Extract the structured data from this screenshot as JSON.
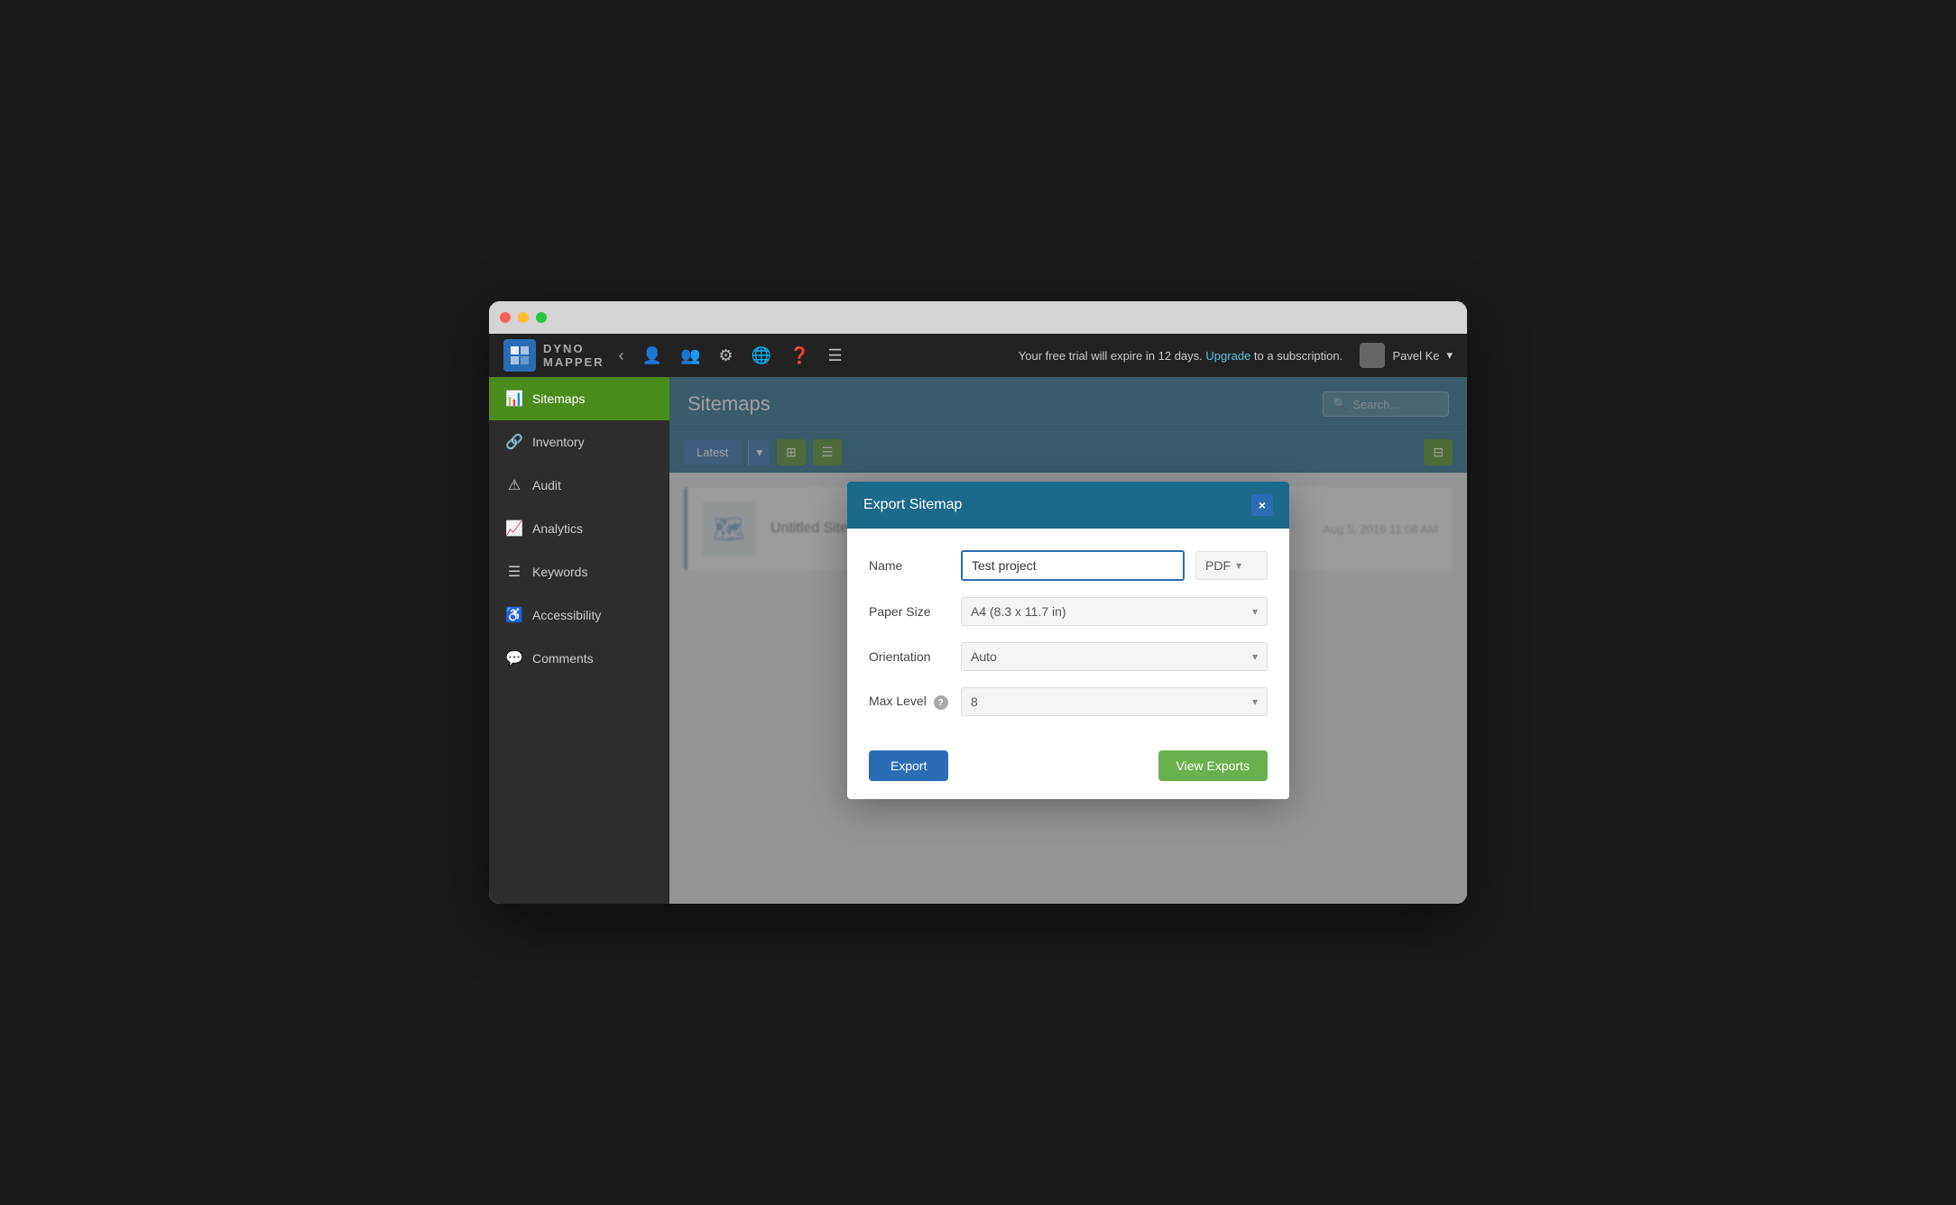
{
  "browser": {
    "dots": [
      "red",
      "yellow",
      "green"
    ]
  },
  "topnav": {
    "logo_text": "DYNO\nMAPPER",
    "trial_message": "Your free trial will expire in 12 days.",
    "upgrade_text": "Upgrade",
    "trial_suffix": " to a subscription.",
    "user_name": "Pavel Ke",
    "nav_icons": [
      "user-icon",
      "user-add-icon",
      "gear-icon",
      "globe-icon",
      "help-icon",
      "menu-icon"
    ]
  },
  "sidebar": {
    "items": [
      {
        "id": "sitemaps",
        "label": "Sitemaps",
        "icon": "📊",
        "active": true
      },
      {
        "id": "inventory",
        "label": "Inventory",
        "icon": "🔗"
      },
      {
        "id": "audit",
        "label": "Audit",
        "icon": "⚠"
      },
      {
        "id": "analytics",
        "label": "Analytics",
        "icon": "📈"
      },
      {
        "id": "keywords",
        "label": "Keywords",
        "icon": "☰"
      },
      {
        "id": "accessibility",
        "label": "Accessibility",
        "icon": "♿"
      },
      {
        "id": "comments",
        "label": "Comments",
        "icon": "💬"
      }
    ]
  },
  "content": {
    "title": "Sitemaps",
    "search_placeholder": "Search...",
    "toolbar": {
      "latest_label": "Latest",
      "grid_view_icon": "grid-icon",
      "list_view_icon": "list-icon",
      "export_icon": "export-icon"
    },
    "sitemap": {
      "name": "Untitled Sitemap",
      "date": "Aug 5, 2019 11:08 AM"
    }
  },
  "modal": {
    "title": "Export Sitemap",
    "close_label": "×",
    "fields": {
      "name_label": "Name",
      "name_value": "Test project",
      "name_placeholder": "Test project",
      "type_label": "PDF",
      "paper_size_label": "Paper Size",
      "paper_size_value": "A4 (8.3 x 11.7 in)",
      "orientation_label": "Orientation",
      "orientation_value": "Auto",
      "max_level_label": "Max Level",
      "max_level_value": "8"
    },
    "export_button": "Export",
    "view_exports_button": "View Exports"
  }
}
